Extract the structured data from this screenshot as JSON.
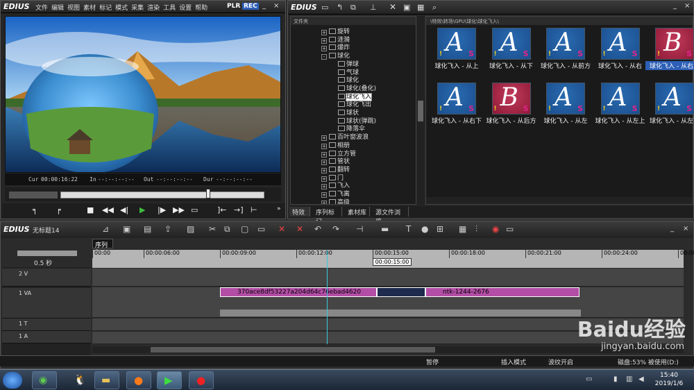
{
  "player": {
    "brand": "EDIUS",
    "menu": [
      "文件",
      "编辑",
      "视图",
      "素材",
      "标记",
      "模式",
      "采集",
      "渲染",
      "工具",
      "设置",
      "帮助"
    ],
    "plr": "PLR",
    "rec": "REC",
    "minimize": "_",
    "close": "×",
    "cur_label": "Cur",
    "cur": "00:00:16:22",
    "in_label": "In",
    "in": "--:--:--:--",
    "out_label": "Out",
    "out": "--:--:--:--",
    "dur_label": "Dur",
    "dur": "--:--:--:--"
  },
  "bin": {
    "brand": "EDIUS",
    "tree_header": "文件夹",
    "path": "\\特效\\转场\\GPU\\球化\\球化飞入\\",
    "tree": [
      {
        "t": "旋转",
        "d": 0,
        "e": "+"
      },
      {
        "t": "涟漪",
        "d": 0,
        "e": "+"
      },
      {
        "t": "爆炸",
        "d": 0,
        "e": "+"
      },
      {
        "t": "球化",
        "d": 0,
        "e": "-"
      },
      {
        "t": "弹球",
        "d": 1
      },
      {
        "t": "气球",
        "d": 1
      },
      {
        "t": "球化",
        "d": 1
      },
      {
        "t": "球化(叠化)",
        "d": 1
      },
      {
        "t": "球化飞入",
        "d": 1,
        "sel": true
      },
      {
        "t": "球化飞出",
        "d": 1
      },
      {
        "t": "球状",
        "d": 1
      },
      {
        "t": "球状(弹跳)",
        "d": 1
      },
      {
        "t": "降落伞",
        "d": 1
      },
      {
        "t": "百叶窗波浪",
        "d": 0,
        "e": "+"
      },
      {
        "t": "相册",
        "d": 0,
        "e": "+"
      },
      {
        "t": "立方管",
        "d": 0,
        "e": "+"
      },
      {
        "t": "管状",
        "d": 0,
        "e": "+"
      },
      {
        "t": "翻转",
        "d": 0,
        "e": "+"
      },
      {
        "t": "门",
        "d": 0,
        "e": "+"
      },
      {
        "t": "飞入",
        "d": 0,
        "e": "+"
      },
      {
        "t": "飞离",
        "d": 0,
        "e": "+"
      },
      {
        "t": "高级",
        "d": 0,
        "e": "+"
      }
    ],
    "items": [
      {
        "label": "球化飞入 - 从上",
        "letter": "A",
        "color": "#1a4f8e"
      },
      {
        "label": "球化飞入 - 从下",
        "letter": "A",
        "color": "#1a4f8e"
      },
      {
        "label": "球化飞入 - 从前方",
        "letter": "A",
        "color": "#1a4f8e"
      },
      {
        "label": "球化飞入 - 从右",
        "letter": "A",
        "color": "#1a4f8e"
      },
      {
        "label": "球化飞入 - 从右上",
        "letter": "B",
        "color": "#8e1a38",
        "sel": true
      },
      {
        "label": "球化飞入 - 从右下",
        "letter": "A",
        "color": "#1a4f8e"
      },
      {
        "label": "球化飞入 - 从后方",
        "letter": "B",
        "color": "#8e1a38"
      },
      {
        "label": "球化飞入 - 从左",
        "letter": "A",
        "color": "#1a4f8e"
      },
      {
        "label": "球化飞入 - 从左上",
        "letter": "A",
        "color": "#1a4f8e"
      },
      {
        "label": "球化飞入 - 从左下",
        "letter": "A",
        "color": "#1a4f8e"
      }
    ],
    "tabs": [
      "特效",
      "序列标记",
      "素材库",
      "源文件浏览"
    ]
  },
  "timeline": {
    "brand": "EDIUS",
    "project": "无标题14",
    "sequence": "序列1",
    "zoom": "0.5 秒",
    "ruler": [
      "00:00",
      "00:00:06:00",
      "00:00:09:00",
      "00:00:12:00",
      "00:00:15:00",
      "00:00:18:00",
      "00:00:21:00",
      "00:00:24:00",
      "00:00"
    ],
    "cursor_time": "00:00:15:00",
    "tracks": [
      {
        "label": "2 V"
      },
      {
        "label": "1 VA"
      },
      {
        "label": "1 T"
      },
      {
        "label": "1 A"
      }
    ],
    "clip1": "370ace8df53227a204d64c76ebad4620",
    "clip2": "ntk-1244-2676"
  },
  "status": {
    "pause": "暂停",
    "insert": "插入模式",
    "ripple": "波纹开启",
    "disk": "磁盘:53% 被使用(D:)"
  },
  "taskbar": {
    "time": "15:40",
    "date": "2019/1/6"
  },
  "watermark": {
    "logo": "Baidu经验",
    "url": "jingyan.baidu.com"
  },
  "colors": {
    "rec": "#2d5fb7",
    "clip": "#b34ea6",
    "selection": "#2d5fb7"
  }
}
